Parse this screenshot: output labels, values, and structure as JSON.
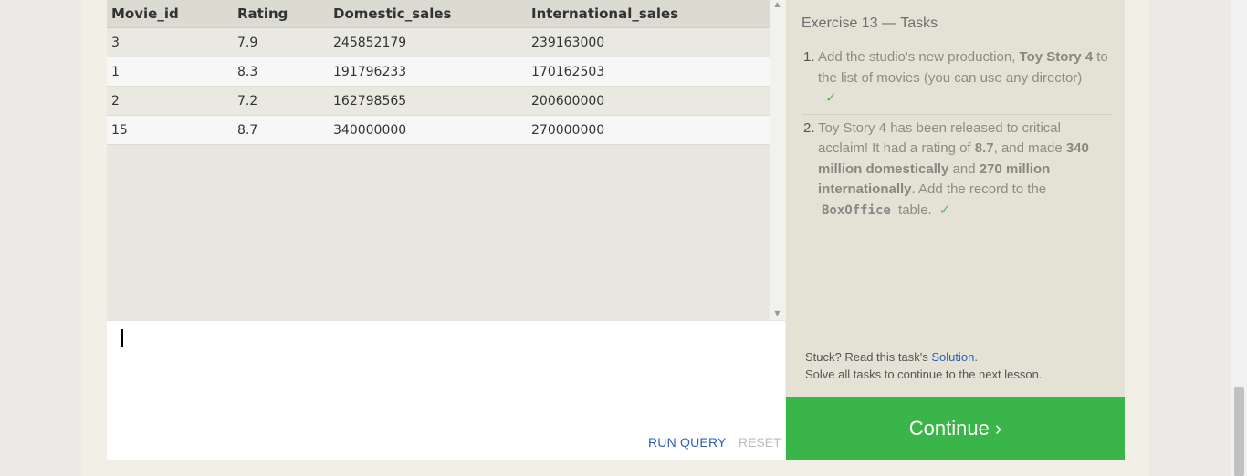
{
  "results": {
    "columns": [
      "Movie_id",
      "Rating",
      "Domestic_sales",
      "International_sales"
    ],
    "rows": [
      [
        "3",
        "7.9",
        "245852179",
        "239163000"
      ],
      [
        "1",
        "8.3",
        "191796233",
        "170162503"
      ],
      [
        "2",
        "7.2",
        "162798565",
        "200600000"
      ],
      [
        "15",
        "8.7",
        "340000000",
        "270000000"
      ]
    ]
  },
  "editor": {
    "value": "",
    "run_label": "RUN QUERY",
    "reset_label": "RESET"
  },
  "tasks": {
    "title": "Exercise 13 — Tasks",
    "items": [
      {
        "num": "1.",
        "text_before": "Add the studio's new production, ",
        "bold1": "Toy Story 4",
        "text_after": " to the list of movies (you can use any director)",
        "check": "✓"
      },
      {
        "num": "2.",
        "t1": "Toy Story 4 has been released to critical acclaim! It had a rating of ",
        "b1": "8.7",
        "t2": ", and made ",
        "b2": "340 million domestically",
        "t3": " and ",
        "b3": "270 million internationally",
        "t4": ". Add the record to the ",
        "code": "BoxOffice",
        "t5": " table.",
        "check": "✓"
      }
    ],
    "stuck_prefix": "Stuck? Read this task's ",
    "solution_link": "Solution",
    "stuck_suffix": ".",
    "solve_all": "Solve all tasks to continue to the next lesson."
  },
  "continue_label": "Continue ›",
  "colors": {
    "continue_bg": "#3ab54a",
    "link": "#2c62b8",
    "check": "#5cb85c"
  }
}
